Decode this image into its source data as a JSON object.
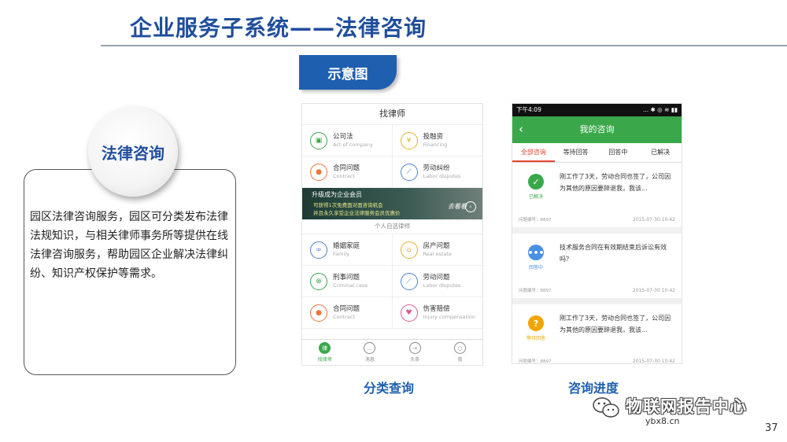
{
  "slide": {
    "title": "企业服务子系统——法律咨询",
    "badge": "示意图",
    "circle_label": "法律咨询",
    "description": "园区法律咨询服务，园区可分类发布法律法规知识，与相关律师事务所等提供在线法律咨询服务，帮助园区企业解决法律纠纷、知识产权保护等需求。",
    "caption_left": "分类查询",
    "caption_right": "咨询进度",
    "watermark": "物联网报告中心",
    "watermark_url": "ybx8.cn",
    "page_number": "37"
  },
  "phone1": {
    "header": "找律师",
    "categories_top": [
      {
        "name": "公司法",
        "en": "Act of company",
        "icon": "briefcase-icon",
        "color": "#3aa84a"
      },
      {
        "name": "投融资",
        "en": "Financing",
        "icon": "yen-icon",
        "color": "#e0b12b"
      },
      {
        "name": "合同问题",
        "en": "Contract",
        "icon": "person-icon",
        "color": "#e8763a"
      },
      {
        "name": "劳动纠纷",
        "en": "Labor disputes",
        "icon": "handshake-icon",
        "color": "#4a7fd0"
      }
    ],
    "banner": {
      "line1": "升级成为企业会员",
      "line2": "可获得1次免费面对面咨询机会",
      "line3": "并且永久享受企业法律服务会员优惠价",
      "cta": "去看看"
    },
    "section_label": "个人自选律师",
    "categories_bottom": [
      {
        "name": "婚姻家庭",
        "en": "Family",
        "icon": "rings-icon",
        "color": "#4a7fd0"
      },
      {
        "name": "房产问题",
        "en": "Real estate",
        "icon": "house-icon",
        "color": "#e0b12b"
      },
      {
        "name": "刑事问题",
        "en": "Criminal case",
        "icon": "handcuffs-icon",
        "color": "#3aa84a"
      },
      {
        "name": "劳动问题",
        "en": "Labor disputes",
        "icon": "handshake-icon",
        "color": "#4a7fd0"
      },
      {
        "name": "合同问题",
        "en": "Contract",
        "icon": "person-icon",
        "color": "#e8763a"
      },
      {
        "name": "伤害赔偿",
        "en": "Injury compensation",
        "icon": "heart-icon",
        "color": "#e05a8a"
      }
    ],
    "nav": [
      {
        "label": "找律师",
        "glyph": "律",
        "active": true
      },
      {
        "label": "消息",
        "glyph": "…",
        "active": false
      },
      {
        "label": "头条",
        "glyph": "→",
        "active": false
      },
      {
        "label": "我",
        "glyph": "○",
        "active": false
      }
    ]
  },
  "phone2": {
    "status_time": "下午4:09",
    "status_icons": "... ✱ ◎ ≋ ▮▮",
    "title": "我的咨询",
    "back_glyph": "‹",
    "tabs": [
      {
        "label": "全部咨询",
        "active": true
      },
      {
        "label": "等待回答",
        "active": false
      },
      {
        "label": "回答中",
        "active": false
      },
      {
        "label": "已解决",
        "active": false
      }
    ],
    "items": [
      {
        "status": "已解决",
        "glyph": "✓",
        "color": "#3aa84a",
        "qid": "问题编号：8897",
        "text": "刚工作了3天，劳动合同也签了，公司因为其他的原因要辞退我，我该...",
        "time": "2015-07-30  10:42"
      },
      {
        "status": "回答中",
        "glyph": "•••",
        "color": "#4a90e2",
        "qid": "问题编号：8897",
        "text": "技术服务合同在有效期结束后诉讼有效吗？",
        "time": "2015-07-30  10:42"
      },
      {
        "status": "等待回答",
        "glyph": "?",
        "color": "#f0a500",
        "qid": "问题编号：8897",
        "text": "刚工作了3天，劳动合同也签了，公司因为其他的原因要辞退我，我该...",
        "time": "2015-07-30  10:42"
      }
    ]
  }
}
